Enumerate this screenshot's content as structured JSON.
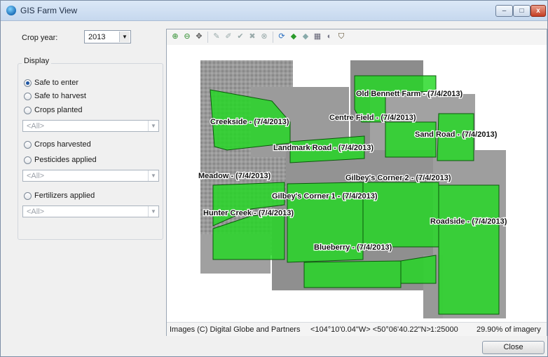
{
  "window": {
    "title": "GIS Farm View",
    "minimize_symbol": "–",
    "maximize_symbol": "□",
    "close_symbol": "x"
  },
  "crop_year": {
    "label": "Crop year:",
    "value": "2013"
  },
  "display": {
    "title": "Display",
    "options": [
      {
        "label": "Safe to enter",
        "checked": true
      },
      {
        "label": "Safe to harvest",
        "checked": false
      },
      {
        "label": "Crops planted",
        "checked": false
      },
      {
        "label": "Crops harvested",
        "checked": false
      },
      {
        "label": "Pesticides applied",
        "checked": false
      },
      {
        "label": "Fertilizers applied",
        "checked": false
      }
    ],
    "crops_planted_filter": "<All>",
    "pesticides_filter": "<All>",
    "fertilizers_filter": "<All>"
  },
  "toolbar": {
    "tools": [
      "zoom-in-icon",
      "zoom-out-icon",
      "pan-icon",
      "draw-icon",
      "edit-icon",
      "accept-icon",
      "delete-icon",
      "cancel-icon",
      "refresh-icon",
      "layer-add-icon",
      "layer-remove-icon",
      "grid-icon",
      "camera-icon",
      "lock-icon"
    ]
  },
  "fields": [
    {
      "name": "Old Bennett Farm - (7/4/2013)"
    },
    {
      "name": "Centre Field - (7/4/2013)"
    },
    {
      "name": "Creekside - (7/4/2013)"
    },
    {
      "name": "Sand Road - (7/4/2013)"
    },
    {
      "name": "Landmark Road - (7/4/2013)"
    },
    {
      "name": "Meadow - (7/4/2013)"
    },
    {
      "name": "Gilbey's Corner 2 - (7/4/2013)"
    },
    {
      "name": "Gilbey's Corner 1 - (7/4/2013)"
    },
    {
      "name": "Hunter Creek - (7/4/2013)"
    },
    {
      "name": "Roadside - (7/4/2013)"
    },
    {
      "name": "Blueberry - (7/4/2013)"
    }
  ],
  "status": {
    "attribution": "Images (C) Digital Globe and Partners",
    "coordinates": "<104°10'0.04\"W> <50°06'40.22\"N>",
    "scale": "1:25000",
    "imagery": "29.90% of imagery"
  },
  "colors": {
    "field_fill": "#22d822",
    "field_stroke": "#0a5a0a",
    "imagery": "#8f8f8f"
  },
  "close_button": "Close"
}
